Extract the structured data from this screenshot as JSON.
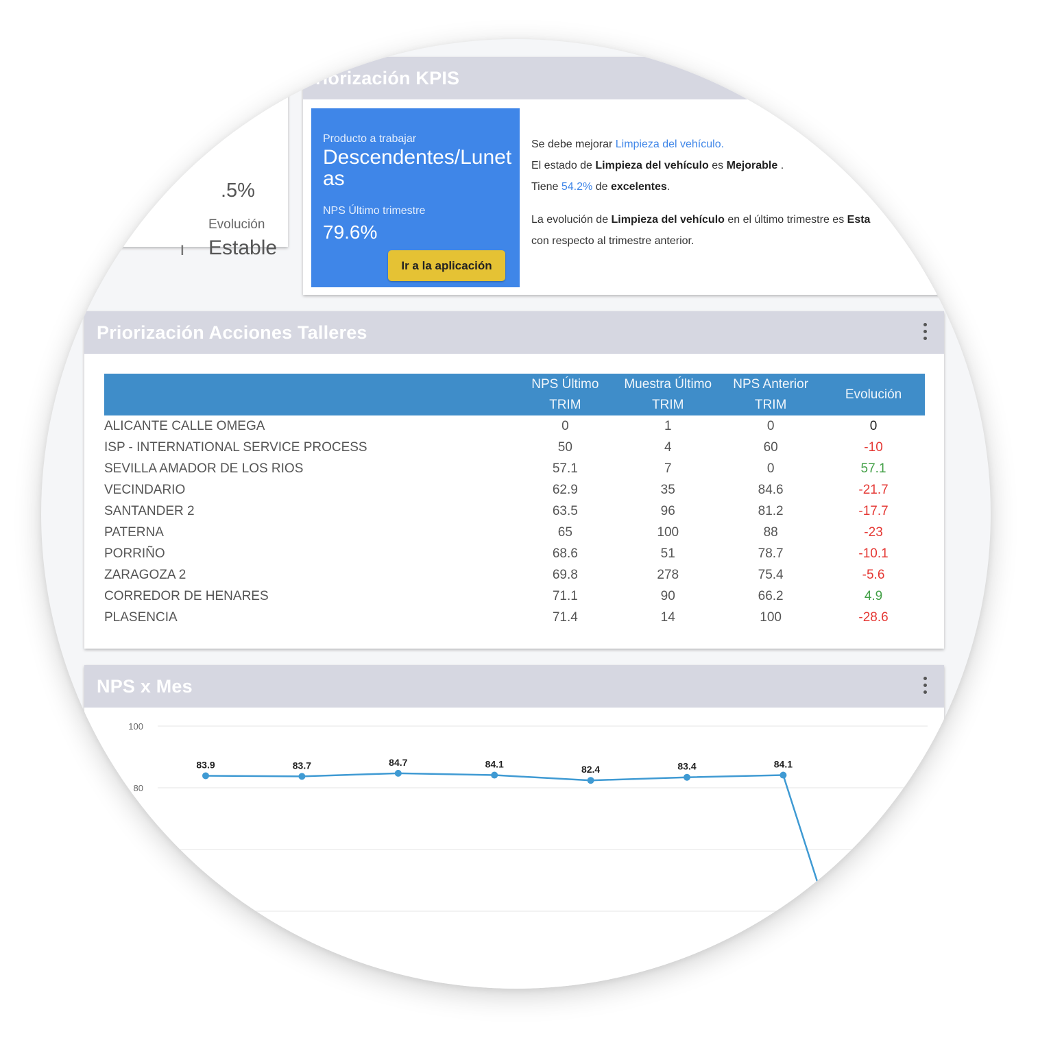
{
  "stat_card": {
    "value_partial": ".5%",
    "evolution_label": "Evolución",
    "evolution_value": "Estable",
    "cut_mark": "ı"
  },
  "kpi": {
    "header": "riorización KPIS",
    "box": {
      "product_label": "Producto a trabajar",
      "product_value": "Descendentes/Lunetas",
      "nps_label": "NPS Último trimestre",
      "nps_value": "79.6%",
      "button_label": "Ir a la aplicación",
      "background": "#3f86e8",
      "button_color": "#e5c234"
    },
    "text": {
      "l1_pre": "Se debe mejorar ",
      "l1_link": "Limpieza del vehículo.",
      "l2_pre": "El estado de ",
      "l2_bold1": "Limpieza del vehículo",
      "l2_mid": " es ",
      "l2_bold2": "Mejorable",
      "l2_post": " .",
      "l3_pre": "Tiene ",
      "l3_pct": "54.2%",
      "l3_mid": " de ",
      "l3_bold": "excelentes",
      "l3_post": ".",
      "l4_pre": "La evolución de ",
      "l4_bold": "Limpieza del vehículo",
      "l4_mid": " en el último trimestre es ",
      "l4_bold2": "Esta",
      "l5": "con respecto al trimestre anterior."
    }
  },
  "talleres": {
    "header": "Priorización Acciones Talleres",
    "columns": [
      {
        "line1": "",
        "line2": ""
      },
      {
        "line1": "NPS Último",
        "line2": "TRIM"
      },
      {
        "line1": "Muestra Último",
        "line2": "TRIM"
      },
      {
        "line1": "NPS Anterior",
        "line2": "TRIM"
      },
      {
        "line1": "Evolución",
        "line2": ""
      }
    ],
    "rows": [
      {
        "name": "ALICANTE CALLE OMEGA",
        "nps": "0",
        "muestra": "1",
        "anterior": "0",
        "evolucion": "0",
        "trend": "zero"
      },
      {
        "name": "ISP - INTERNATIONAL SERVICE PROCESS",
        "nps": "50",
        "muestra": "4",
        "anterior": "60",
        "evolucion": "-10",
        "trend": "neg"
      },
      {
        "name": "SEVILLA AMADOR DE LOS RIOS",
        "nps": "57.1",
        "muestra": "7",
        "anterior": "0",
        "evolucion": "57.1",
        "trend": "pos"
      },
      {
        "name": "VECINDARIO",
        "nps": "62.9",
        "muestra": "35",
        "anterior": "84.6",
        "evolucion": "-21.7",
        "trend": "neg"
      },
      {
        "name": "SANTANDER 2",
        "nps": "63.5",
        "muestra": "96",
        "anterior": "81.2",
        "evolucion": "-17.7",
        "trend": "neg"
      },
      {
        "name": "PATERNA",
        "nps": "65",
        "muestra": "100",
        "anterior": "88",
        "evolucion": "-23",
        "trend": "neg"
      },
      {
        "name": "PORRIÑO",
        "nps": "68.6",
        "muestra": "51",
        "anterior": "78.7",
        "evolucion": "-10.1",
        "trend": "neg"
      },
      {
        "name": "ZARAGOZA 2",
        "nps": "69.8",
        "muestra": "278",
        "anterior": "75.4",
        "evolucion": "-5.6",
        "trend": "neg"
      },
      {
        "name": "CORREDOR DE HENARES",
        "nps": "71.1",
        "muestra": "90",
        "anterior": "66.2",
        "evolucion": "4.9",
        "trend": "pos"
      },
      {
        "name": "PLASENCIA",
        "nps": "71.4",
        "muestra": "14",
        "anterior": "100",
        "evolucion": "-28.6",
        "trend": "neg"
      }
    ]
  },
  "chart_card": {
    "header": "NPS x Mes"
  },
  "chart_data": {
    "type": "line",
    "title": "",
    "xlabel": "",
    "ylabel": "",
    "y_ticks": [
      "100",
      "80"
    ],
    "ylim": [
      40,
      100
    ],
    "grid": true,
    "line_color": "#3f9ad3",
    "points": [
      {
        "label": "83.9",
        "value": 83.9
      },
      {
        "label": "83.7",
        "value": 83.7
      },
      {
        "label": "84.7",
        "value": 84.7
      },
      {
        "label": "84.1",
        "value": 84.1
      },
      {
        "label": "82.4",
        "value": 82.4
      },
      {
        "label": "83.4",
        "value": 83.4
      },
      {
        "label": "84.1",
        "value": 84.1
      }
    ],
    "trailing_drop": true
  }
}
